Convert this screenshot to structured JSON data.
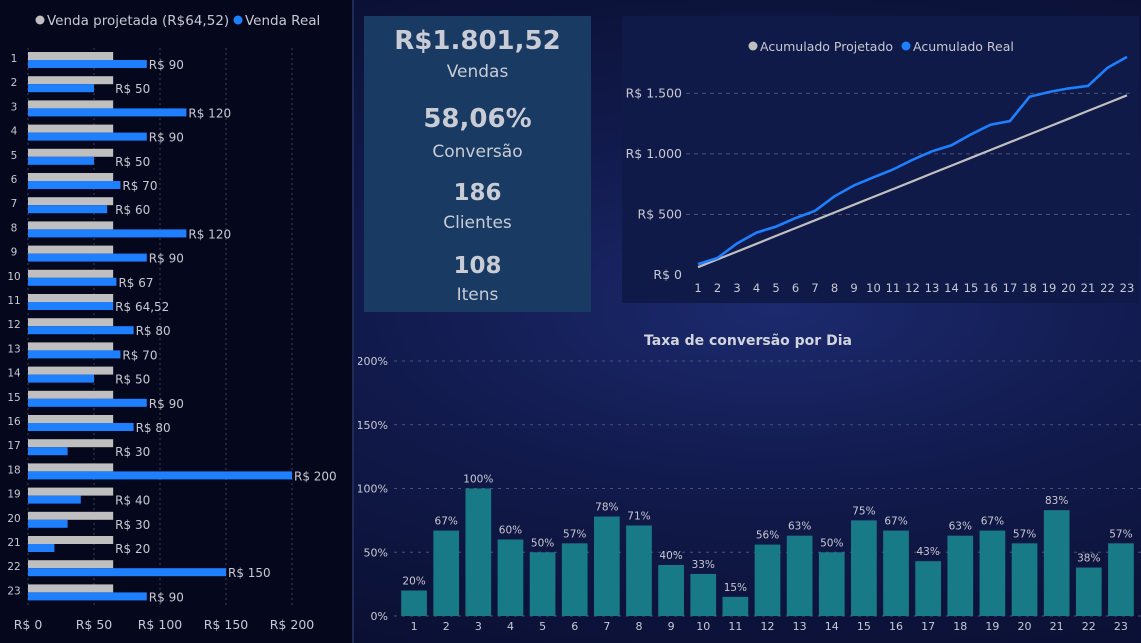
{
  "colors": {
    "projected": "#bfbfbf",
    "real": "#1e7fff",
    "bar": "#177a86",
    "text": "#c8c8d2"
  },
  "kpis": [
    {
      "value": "R$1.801,52",
      "label": "Vendas"
    },
    {
      "value": "58,06%",
      "label": "Conversão"
    },
    {
      "value": "186",
      "label": "Clientes"
    },
    {
      "value": "108",
      "label": "Itens"
    }
  ],
  "chart_data": [
    {
      "type": "bar",
      "orientation": "horizontal",
      "categories": [
        "1",
        "2",
        "3",
        "4",
        "5",
        "6",
        "7",
        "8",
        "9",
        "10",
        "11",
        "12",
        "13",
        "14",
        "15",
        "16",
        "17",
        "18",
        "19",
        "20",
        "21",
        "22",
        "23"
      ],
      "series": [
        {
          "name": "Venda projetada (R$64,52)",
          "values": [
            64.52,
            64.52,
            64.52,
            64.52,
            64.52,
            64.52,
            64.52,
            64.52,
            64.52,
            64.52,
            64.52,
            64.52,
            64.52,
            64.52,
            64.52,
            64.52,
            64.52,
            64.52,
            64.52,
            64.52,
            64.52,
            64.52,
            64.52
          ]
        },
        {
          "name": "Venda Real",
          "values": [
            90,
            50,
            120,
            90,
            50,
            70,
            60,
            120,
            90,
            67,
            64.52,
            80,
            70,
            50,
            90,
            80,
            30,
            200,
            40,
            30,
            20,
            150,
            90
          ]
        }
      ],
      "data_labels": [
        "R$ 90",
        "R$ 50",
        "R$ 120",
        "R$ 90",
        "R$ 50",
        "R$ 70",
        "R$ 60",
        "R$ 120",
        "R$ 90",
        "R$ 67",
        "R$ 64,52",
        "R$ 80",
        "R$ 70",
        "R$ 50",
        "R$ 90",
        "R$ 80",
        "R$ 30",
        "R$ 200",
        "R$ 40",
        "R$ 30",
        "R$ 20",
        "R$ 150",
        "R$ 90"
      ],
      "xticks": [
        "R$ 0",
        "R$ 50",
        "R$ 100",
        "R$ 150",
        "R$ 200"
      ],
      "xlim": [
        0,
        200
      ],
      "legend": "top"
    },
    {
      "type": "line",
      "x": [
        1,
        2,
        3,
        4,
        5,
        6,
        7,
        8,
        9,
        10,
        11,
        12,
        13,
        14,
        15,
        16,
        17,
        18,
        19,
        20,
        21,
        22,
        23
      ],
      "series": [
        {
          "name": "Acumulado Projetado",
          "values": [
            64.52,
            129.04,
            193.56,
            258.08,
            322.6,
            387.12,
            451.64,
            516.16,
            580.68,
            645.2,
            709.72,
            774.24,
            838.76,
            903.28,
            967.8,
            1032.32,
            1096.84,
            1161.36,
            1225.88,
            1290.4,
            1354.92,
            1419.44,
            1483.96
          ]
        },
        {
          "name": "Acumulado Real",
          "values": [
            90,
            140,
            260,
            350,
            400,
            470,
            530,
            650,
            740,
            807,
            871.52,
            951.52,
            1021.52,
            1071.52,
            1161.52,
            1241.52,
            1271.52,
            1471.52,
            1511.52,
            1541.52,
            1561.52,
            1711.52,
            1801.52
          ]
        }
      ],
      "yticks": [
        "R$ 0",
        "R$ 500",
        "R$ 1.000",
        "R$ 1.500"
      ],
      "ylim": [
        0,
        1850
      ],
      "legend": "top"
    },
    {
      "type": "bar",
      "title": "Taxa de conversão por Dia",
      "categories": [
        "1",
        "2",
        "3",
        "4",
        "5",
        "6",
        "7",
        "8",
        "9",
        "10",
        "11",
        "12",
        "13",
        "14",
        "15",
        "16",
        "17",
        "18",
        "19",
        "20",
        "21",
        "22",
        "23"
      ],
      "values": [
        20,
        67,
        100,
        60,
        50,
        57,
        78,
        71,
        40,
        33,
        15,
        56,
        63,
        50,
        75,
        67,
        43,
        63,
        67,
        57,
        83,
        38,
        57
      ],
      "data_labels": [
        "20%",
        "67%",
        "100%",
        "60%",
        "50%",
        "57%",
        "78%",
        "71%",
        "40%",
        "33%",
        "15%",
        "56%",
        "63%",
        "50%",
        "75%",
        "67%",
        "43%",
        "63%",
        "67%",
        "57%",
        "83%",
        "38%",
        "57%"
      ],
      "yticks": [
        "0%",
        "50%",
        "100%",
        "150%",
        "200%"
      ],
      "ylim": [
        0,
        200
      ]
    }
  ]
}
